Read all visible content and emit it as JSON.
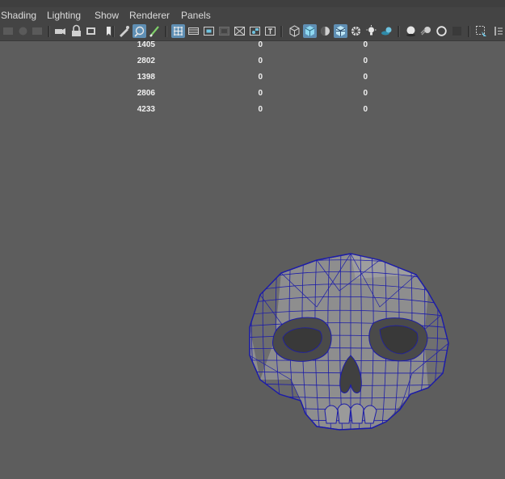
{
  "menu": [
    "Shading",
    "Lighting",
    "Show",
    "Renderer",
    "Panels"
  ],
  "toolbar_icons": [
    "select-camera-icon",
    "camera-attributes-icon",
    "bookmarks-icon",
    "camera-icon",
    "lock-camera-icon",
    "image-plane-icon",
    "bookmark-icon",
    "2d-pan-zoom-icon",
    "grease-pencil-icon",
    "paint-icon",
    "grid-icon",
    "film-gate-icon",
    "resolution-gate-icon",
    "gate-mask-icon",
    "field-chart-icon",
    "safe-action-icon",
    "safe-title-icon",
    "wireframe-icon",
    "smooth-shade-icon",
    "default-material-icon",
    "wireframe-on-shaded-icon",
    "xray-icon",
    "use-all-lights-icon",
    "shadows-icon",
    "ambient-occlusion-icon",
    "motion-blur-icon",
    "anti-aliasing-icon",
    "depth-of-field-icon",
    "isolate-select-icon",
    "xray-joints-icon"
  ],
  "hud": {
    "rows": [
      [
        "1405",
        "0",
        "0"
      ],
      [
        "2802",
        "0",
        "0"
      ],
      [
        "1398",
        "0",
        "0"
      ],
      [
        "2806",
        "0",
        "0"
      ],
      [
        "4233",
        "0",
        "0"
      ]
    ]
  },
  "colors": {
    "viewport": "#5d5d5d",
    "toolbar": "#444444",
    "active_button": "#5f8fb4",
    "wireframe": "#1c1ca8"
  }
}
